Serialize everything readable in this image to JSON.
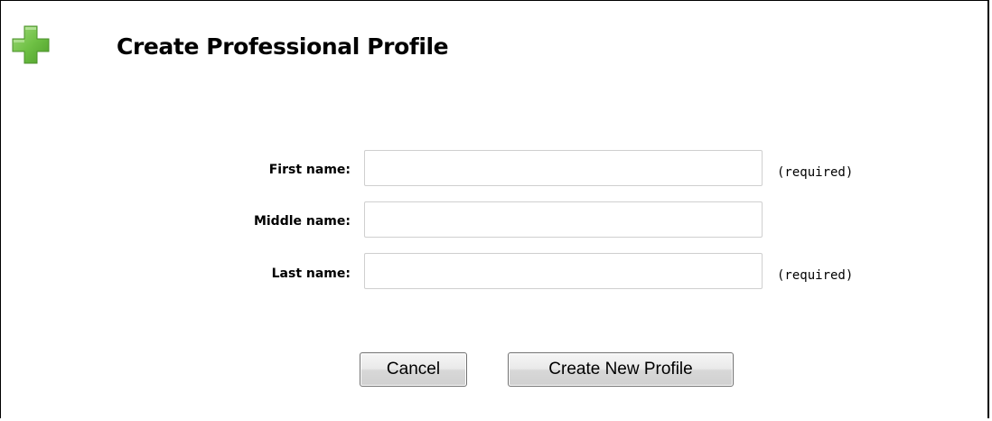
{
  "header": {
    "title": "Create Professional Profile",
    "icon": "plus-icon",
    "icon_color": "#6fc145"
  },
  "form": {
    "fields": [
      {
        "label": "First name:",
        "value": "",
        "note": "(required)"
      },
      {
        "label": "Middle name:",
        "value": "",
        "note": ""
      },
      {
        "label": "Last name:",
        "value": "",
        "note": "(required)"
      }
    ]
  },
  "buttons": {
    "cancel_label": "Cancel",
    "create_label": "Create New Profile"
  }
}
